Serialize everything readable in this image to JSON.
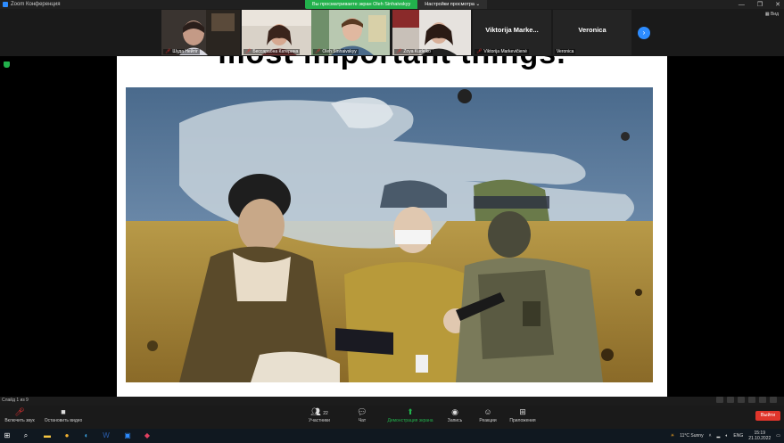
{
  "window": {
    "title": "Zoom Конференция"
  },
  "share": {
    "banner": "Вы просматриваете экран Oleh Sinhaivskyy",
    "settings": "Настройки просмотра"
  },
  "participants": [
    {
      "name": "Шуда Нейтіг",
      "muted": true
    },
    {
      "name": "Бессарабна Катерина",
      "muted": true
    },
    {
      "name": "Oleh Sinhaivskyy",
      "muted": true
    },
    {
      "name": "Zoya Kudelko",
      "muted": true
    },
    {
      "name": "Viktorija Markevičienė",
      "display": "Viktorija Marke...",
      "muted": true
    },
    {
      "name": "Veronica",
      "muted": false
    }
  ],
  "view_label": "Вид",
  "slide": {
    "title": "most important things."
  },
  "slide_counter": "Слайд 1 из 9",
  "toolbar": {
    "unmute": "Включить звук",
    "video": "Остановить видео",
    "participants": "Участники",
    "participants_count": "22",
    "chat": "Чат",
    "share": "Демонстрация экрана",
    "record": "Запись",
    "reactions": "Реакции",
    "apps": "Приложения",
    "exit": "Выйти"
  },
  "taskbar": {
    "weather": "11°C Sunny",
    "lang": "ENG",
    "time": "15:19",
    "date": "21.10.2022"
  },
  "colors": {
    "accent": "#2d8cff",
    "share_green": "#22b14c",
    "exit_red": "#e0352b"
  }
}
